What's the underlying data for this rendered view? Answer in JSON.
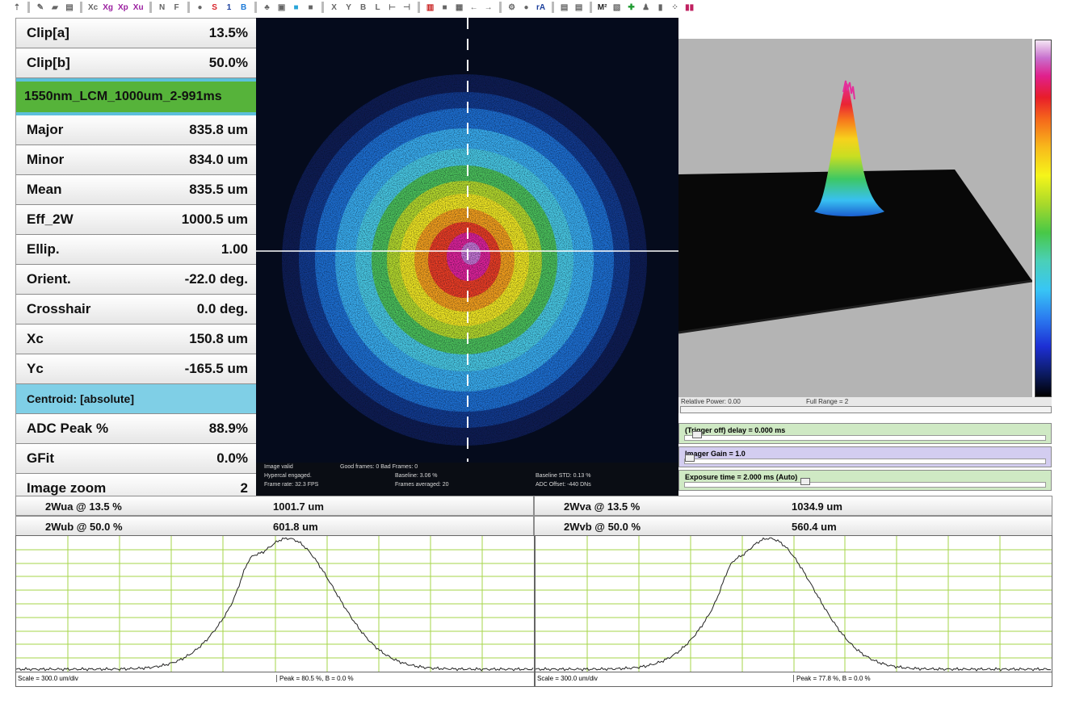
{
  "toolbar": {
    "items": [
      {
        "icon": "arrow-up-icon",
        "text": "⇡"
      },
      {
        "icon": "pencil-icon",
        "text": "✎"
      },
      {
        "icon": "open-folder-icon",
        "text": "▰"
      },
      {
        "icon": "save-icon",
        "text": "▤"
      },
      {
        "icon": "xc-icon",
        "text": "Xc"
      },
      {
        "icon": "xg-icon",
        "text": "Xg"
      },
      {
        "icon": "xp-icon",
        "text": "Xp"
      },
      {
        "icon": "xu-icon",
        "text": "Xu"
      },
      {
        "icon": "n-icon",
        "text": "N"
      },
      {
        "icon": "f-icon",
        "text": "F"
      },
      {
        "icon": "gray-dot-icon",
        "text": "●"
      },
      {
        "icon": "red-s-icon",
        "text": "S"
      },
      {
        "icon": "one-icon",
        "text": "1"
      },
      {
        "icon": "b-circle-icon",
        "text": "B"
      },
      {
        "icon": "people-icon",
        "text": "♣"
      },
      {
        "icon": "lock-icon",
        "text": "▣"
      },
      {
        "icon": "colormap-icon",
        "text": "■"
      },
      {
        "icon": "gray-square-icon",
        "text": "■"
      },
      {
        "icon": "x-icon",
        "text": "X"
      },
      {
        "icon": "y-icon",
        "text": "Y"
      },
      {
        "icon": "b-icon",
        "text": "B"
      },
      {
        "icon": "l-icon",
        "text": "L"
      },
      {
        "icon": "bracket-icon",
        "text": "⊢"
      },
      {
        "icon": "bracket2-icon",
        "text": "⊣"
      },
      {
        "icon": "colorbar-icon",
        "text": "▥"
      },
      {
        "icon": "gray-box-icon",
        "text": "■"
      },
      {
        "icon": "grid-icon",
        "text": "▦"
      },
      {
        "icon": "left-arrow-icon",
        "text": "←"
      },
      {
        "icon": "right-arrow-icon",
        "text": "→"
      },
      {
        "icon": "tool-icon",
        "text": "⚙"
      },
      {
        "icon": "gray-ball-icon",
        "text": "●"
      },
      {
        "icon": "ra-icon",
        "text": "rA"
      },
      {
        "icon": "print-icon",
        "text": "▤"
      },
      {
        "icon": "print2-icon",
        "text": "▤"
      },
      {
        "icon": "m2-icon",
        "text": "M²"
      },
      {
        "icon": "chart-icon",
        "text": "▧"
      },
      {
        "icon": "green-plus-icon",
        "text": "✚"
      },
      {
        "icon": "person-icon",
        "text": "♟"
      },
      {
        "icon": "thermometer-icon",
        "text": "▮"
      },
      {
        "icon": "dots-icon",
        "text": "⁘"
      },
      {
        "icon": "bars-icon",
        "text": "▮▮"
      }
    ]
  },
  "left_panel": {
    "rows": [
      {
        "label": "Clip[a]",
        "value": "13.5%"
      },
      {
        "label": "Clip[b]",
        "value": "50.0%"
      },
      {
        "label": "1550nm_LCM_1000um_2-991ms",
        "value": "",
        "kind": "green"
      },
      {
        "label": "Major",
        "value": "835.8 um"
      },
      {
        "label": "Minor",
        "value": "834.0 um"
      },
      {
        "label": "Mean",
        "value": "835.5 um"
      },
      {
        "label": "Eff_2W",
        "value": "1000.5 um"
      },
      {
        "label": "Ellip.",
        "value": "1.00"
      },
      {
        "label": "Orient.",
        "value": "-22.0 deg."
      },
      {
        "label": "Crosshair",
        "value": "0.0 deg."
      },
      {
        "label": "Xc",
        "value": "150.8 um"
      },
      {
        "label": "Yc",
        "value": "-165.5 um"
      },
      {
        "label": "Centroid: [absolute]",
        "value": "",
        "kind": "cyan"
      },
      {
        "label": "ADC Peak %",
        "value": "88.9%"
      },
      {
        "label": "GFit",
        "value": "0.0%"
      },
      {
        "label": "Image zoom",
        "value": "2"
      }
    ]
  },
  "image_status": {
    "line1a": "Image valid",
    "line1b": "Good frames: 0 Bad Frames: 0",
    "line2a": "Hypercal engaged.",
    "line2b": "Baseline: 3.06 %",
    "line2c": "Baseline STD: 0.13 %",
    "line3a": "Frame rate: 32.3 FPS",
    "line3b": "Frames averaged: 20",
    "line3c": "ADC Offset: -440 DNs"
  },
  "view3d": {
    "relative_power": "Relative Power: 0.00",
    "full_range": "Full Range = 2"
  },
  "controls": {
    "trigger": "(Trigger off) delay = 0.000 ms",
    "gain": "Imager Gain = 1.0",
    "exposure": "Exposure time = 2.000 ms (Auto)",
    "trigger_level": 0.02,
    "gain_level": 0.0,
    "exposure_level": 0.33
  },
  "widths": {
    "u_a_label": "2Wua @ 13.5 %",
    "u_a_value": "1001.7 um",
    "u_b_label": "2Wub @ 50.0 %",
    "u_b_value": "601.8 um",
    "v_a_label": "2Wva @ 13.5 %",
    "v_a_value": "1034.9 um",
    "v_b_label": "2Wvb @ 50.0 %",
    "v_b_value": "560.4 um"
  },
  "profiles": {
    "u_scale": "Scale = 300.0 um/div",
    "u_peak": "Peak = 80.5 %,  B = 0.0 %",
    "v_scale": "Scale = 300.0 um/div",
    "v_peak": "Peak = 77.8 %,  B = 0.0 %"
  },
  "colors": {
    "profile_grid": "#a6d64a",
    "green_bar": "#56b33a",
    "cyan_bar": "#7fcfe6",
    "slider_green": "#cfe9c4",
    "slider_purple": "#d3cdf0"
  }
}
